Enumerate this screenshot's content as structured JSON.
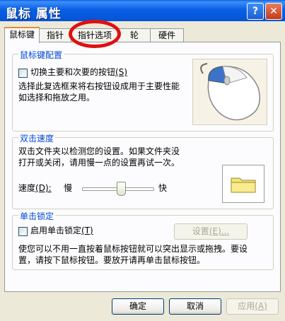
{
  "window": {
    "title": "鼠标 属性",
    "help_label": "?",
    "close_label": "✕"
  },
  "tabs": [
    {
      "label": "鼠标键",
      "active": true
    },
    {
      "label": "指针",
      "active": false
    },
    {
      "label": "指针选项",
      "active": false
    },
    {
      "label": "轮",
      "active": false
    },
    {
      "label": "硬件",
      "active": false
    }
  ],
  "button_config": {
    "title": "鼠标键配置",
    "checkbox_label": "切换主要和次要的按钮",
    "checkbox_hotkey": "(S)",
    "checkbox_checked": false,
    "description_line1": "选择此复选框来将右按钮设成用于主要性能",
    "description_line2": "如选择和拖放之用。"
  },
  "double_click": {
    "title": "双击速度",
    "description_line1": "双击文件夹以检测您的设置。如果文件夹没",
    "description_line2": "打开或关闭，请用慢一点的设置再试一次。",
    "speed_label": "速度",
    "speed_hotkey": "(D):",
    "slow_label": "慢",
    "fast_label": "快",
    "speed_level": 0.55
  },
  "click_lock": {
    "title": "单击锁定",
    "checkbox_label": "启用单击锁定",
    "checkbox_hotkey": "(T)",
    "checkbox_checked": false,
    "settings_button": "设置",
    "settings_hotkey": "(E)...",
    "description_line1": "使您可以不用一直按着鼠标按钮就可以突出显示或拖拽。要设",
    "description_line2": "置，请按下鼠标按钮。要放开请再单击鼠标按钮。"
  },
  "footer": {
    "ok": "确定",
    "cancel": "取消",
    "apply": "应用",
    "apply_hotkey": "(A)"
  },
  "icons": [
    "help-icon",
    "close-icon",
    "mouse-illustration",
    "folder-icon"
  ],
  "colors": {
    "titlebar": "#0A5FE6",
    "group_title": "#0046D5",
    "highlight_oval": "#E01010"
  }
}
